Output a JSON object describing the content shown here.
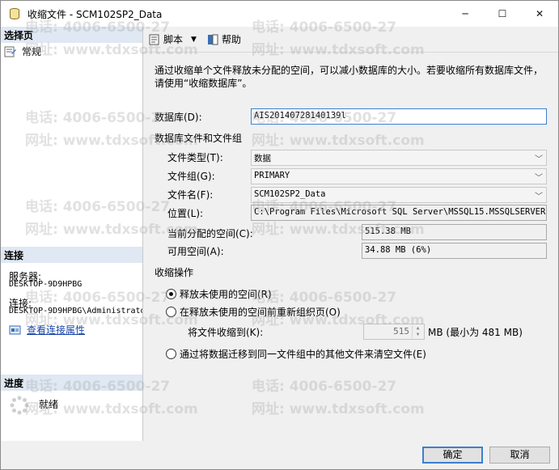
{
  "window": {
    "title": "收缩文件 - SCM102SP2_Data",
    "controls": {
      "minimize": "─",
      "maximize": "☐",
      "close": "✕"
    }
  },
  "left_pane": {
    "select_page_header": "选择页",
    "pages": [
      {
        "label": "常规",
        "icon": "page-icon"
      }
    ],
    "connection_header": "连接",
    "server_label": "服务器:",
    "server_value": "DESKTOP-9D9HPBG",
    "connection_label": "连接:",
    "connection_value": "DESKTOP-9D9HPBG\\Administrato",
    "view_connection_link": "查看连接属性",
    "progress_header": "进度",
    "progress_status": "就绪"
  },
  "toolbar": {
    "script_label": "脚本",
    "help_label": "帮助"
  },
  "main": {
    "description": "通过收缩单个文件释放未分配的空间，可以减小数据库的大小。若要收缩所有数据库文件，请使用“收缩数据库”。",
    "database_label": "数据库(D):",
    "database_value": "AIS20140728140139l",
    "files_group_label": "数据库文件和文件组",
    "file_type_label": "文件类型(T):",
    "file_type_value": "数据",
    "filegroup_label": "文件组(G):",
    "filegroup_value": "PRIMARY",
    "file_name_label": "文件名(F):",
    "file_name_value": "SCM102SP2_Data",
    "location_label": "位置(L):",
    "location_value": "C:\\Program Files\\Microsoft SQL Server\\MSSQL15.MSSQLSERVER\\MSS",
    "allocated_label": "当前分配的空间(C):",
    "allocated_value": "515.38 MB",
    "available_label": "可用空间(A):",
    "available_value": "34.88 MB (6%)",
    "shrink_action_label": "收缩操作",
    "option_release": "释放未使用的空间(R)",
    "option_reorganize": "在释放未使用的空间前重新组织页(O)",
    "shrink_to_label": "将文件收缩到(K):",
    "shrink_to_value": "515",
    "shrink_to_unit": "MB (最小为 481 MB)",
    "option_empty": "通过将数据迁移到同一文件组中的其他文件来清空文件(E)",
    "selected_option": "release"
  },
  "buttons": {
    "ok": "确定",
    "cancel": "取消"
  },
  "watermarks": [
    "电话: 4006-6500-27",
    "网址: www.tdxsoft.com"
  ],
  "colors": {
    "section_header_bg": "#dfe8f3",
    "link": "#1a45a8",
    "focus_border": "#3c7fd0"
  }
}
